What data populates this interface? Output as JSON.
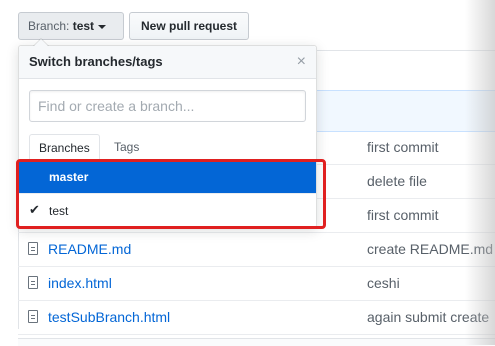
{
  "toolbar": {
    "branch_prefix": "Branch: ",
    "branch_name": "test",
    "new_pr_label": "New pull request"
  },
  "files": [
    {
      "name": "",
      "message": "first commit"
    },
    {
      "name": "",
      "message": "delete file"
    },
    {
      "name": "",
      "message": "first commit"
    },
    {
      "name": "README.md",
      "message": "create README.md"
    },
    {
      "name": "index.html",
      "message": "ceshi"
    },
    {
      "name": "testSubBranch.html",
      "message": "again submit create"
    }
  ],
  "dropdown": {
    "title": "Switch branches/tags",
    "close_glyph": "×",
    "filter_placeholder": "Find or create a branch...",
    "tabs": [
      {
        "label": "Branches",
        "active": true
      },
      {
        "label": "Tags",
        "active": false
      }
    ],
    "branches": [
      {
        "name": "master",
        "highlighted": true,
        "selected": false
      },
      {
        "name": "test",
        "highlighted": false,
        "selected": true
      }
    ],
    "check_glyph": "✔"
  },
  "colors": {
    "highlight": "#0366d6",
    "annotation": "#e02020",
    "link": "#0366d6"
  }
}
